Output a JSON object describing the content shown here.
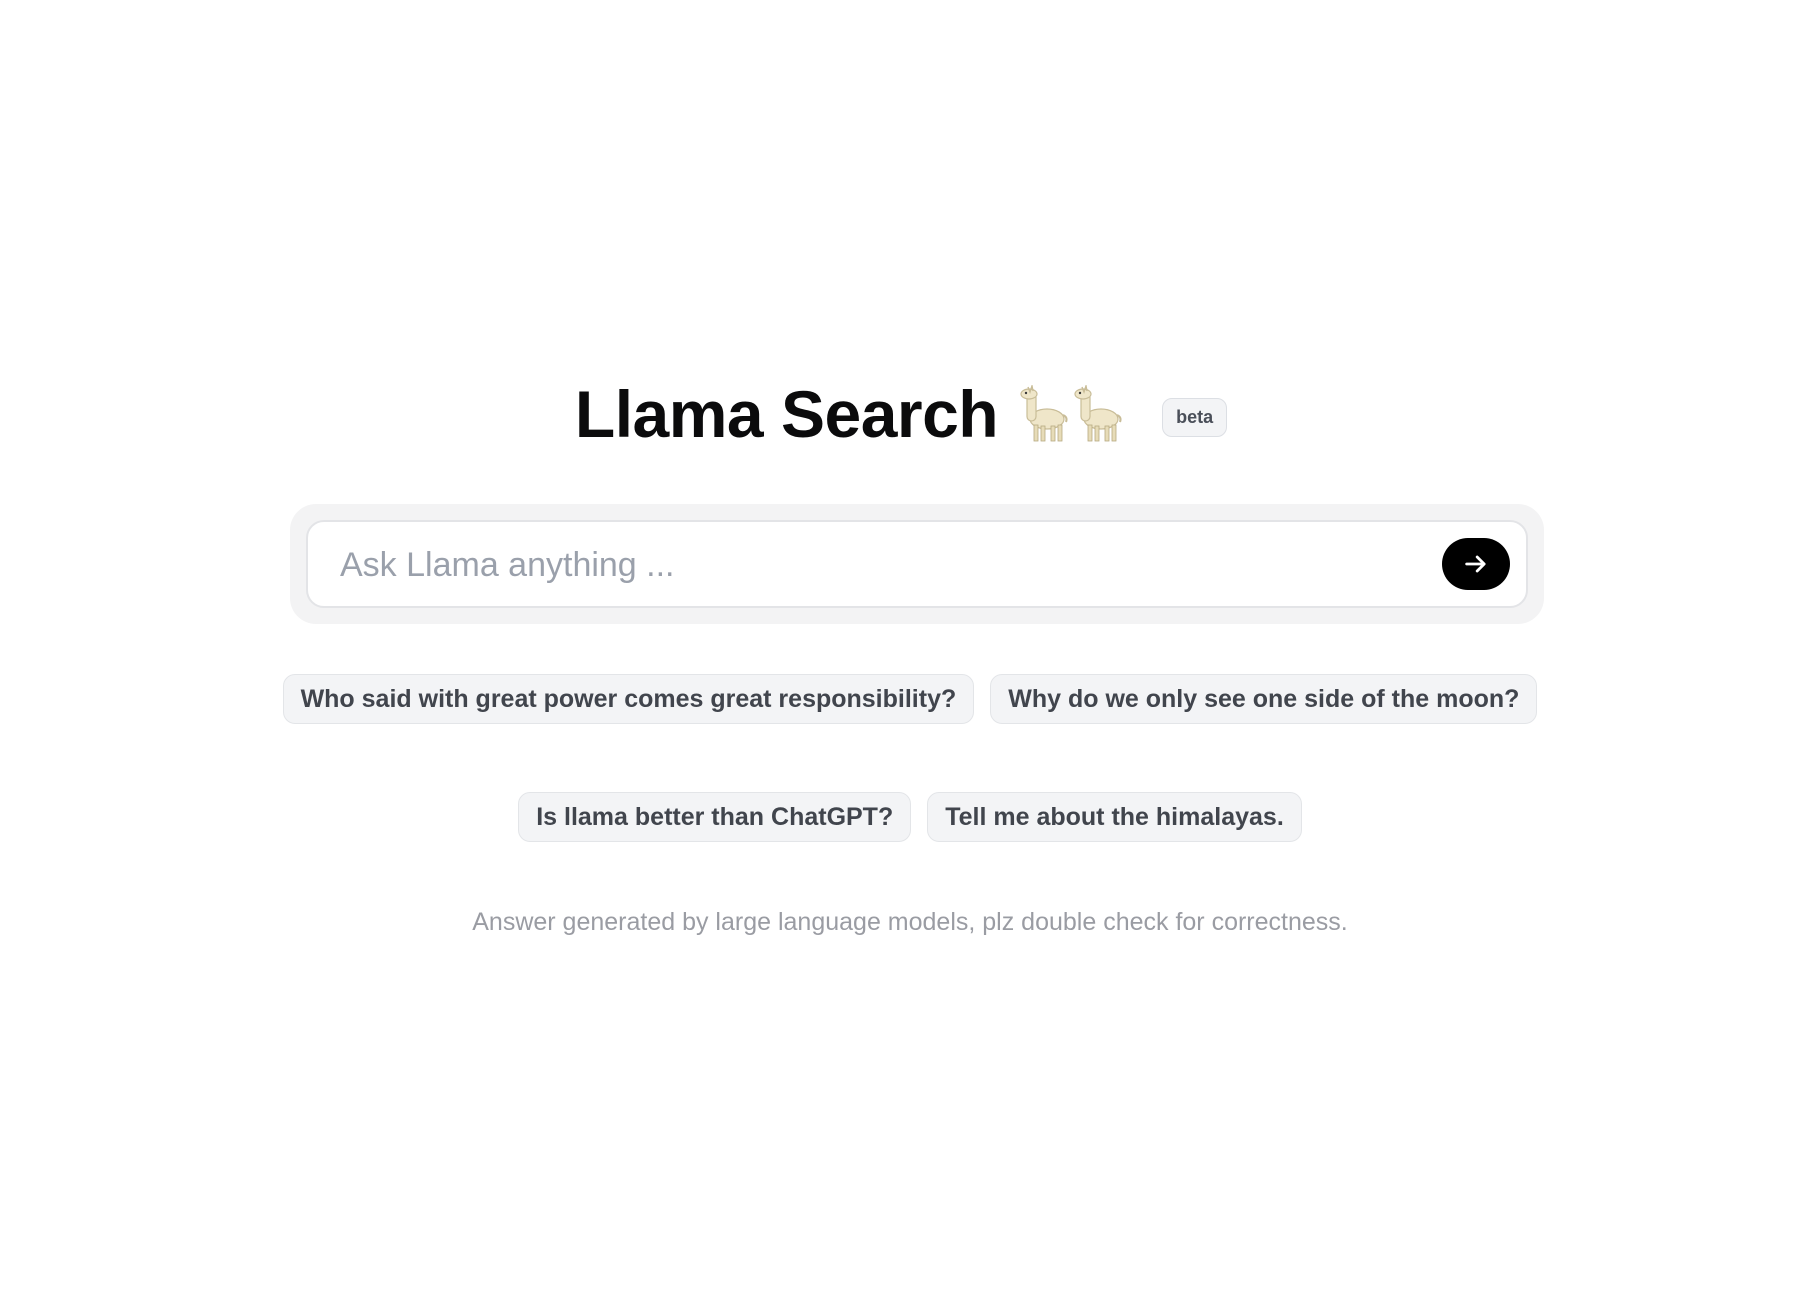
{
  "header": {
    "title": "Llama Search",
    "icons": [
      "llama-icon",
      "llama-icon"
    ],
    "badge": "beta"
  },
  "search": {
    "placeholder": "Ask Llama anything ...",
    "value": "",
    "submit_icon": "arrow-right-icon"
  },
  "suggestions": [
    "Who said with great power comes great responsibility?",
    "Why do we only see one side of the moon?",
    "Is llama better than ChatGPT?",
    "Tell me about the himalayas."
  ],
  "footer": {
    "disclaimer": "Answer generated by large language models, plz double check for correctness."
  },
  "colors": {
    "accent": "#000000",
    "chip_bg": "#f3f4f6",
    "muted_text": "#9a9ca3"
  }
}
